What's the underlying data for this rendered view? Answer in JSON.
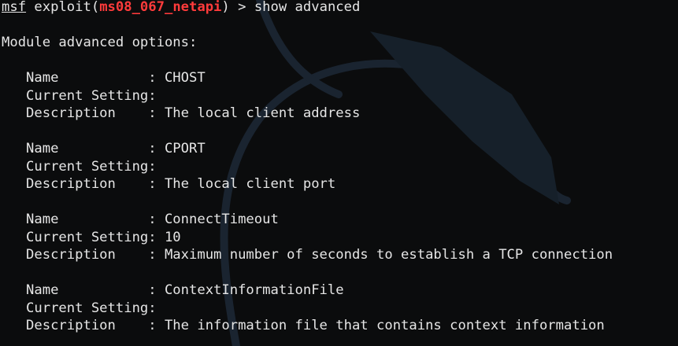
{
  "prompt": {
    "msf": "msf",
    "exploit_open": " exploit(",
    "module": "ms08_067_netapi",
    "exploit_close": ") > ",
    "command": "show advanced"
  },
  "heading": "Module advanced options:",
  "options": [
    {
      "name_line": "   Name           : CHOST",
      "setting_line": "   Current Setting:",
      "desc_line": "   Description    : The local client address"
    },
    {
      "name_line": "   Name           : CPORT",
      "setting_line": "   Current Setting:",
      "desc_line": "   Description    : The local client port"
    },
    {
      "name_line": "   Name           : ConnectTimeout",
      "setting_line": "   Current Setting: 10",
      "desc_line": "   Description    : Maximum number of seconds to establish a TCP connection"
    },
    {
      "name_line": "   Name           : ContextInformationFile",
      "setting_line": "   Current Setting:",
      "desc_line": "   Description    : The information file that contains context information"
    }
  ]
}
